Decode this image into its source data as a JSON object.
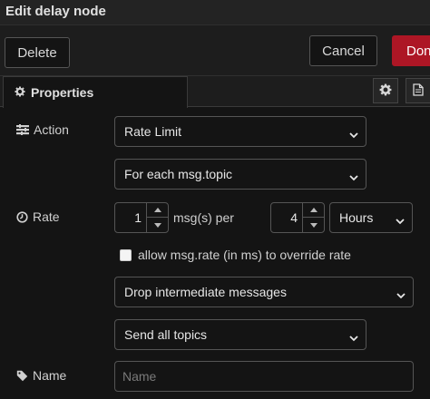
{
  "header": {
    "title": "Edit delay node"
  },
  "toolbar": {
    "delete_label": "Delete",
    "cancel_label": "Cancel",
    "done_label": "Done"
  },
  "tabs": {
    "properties_label": "Properties"
  },
  "form": {
    "action_label": "Action",
    "action_value": "Rate Limit",
    "scope_value": "For each msg.topic",
    "rate_label": "Rate",
    "rate_count": "1",
    "rate_unit_text": "msg(s) per",
    "rate_period": "4",
    "rate_period_unit": "Hours",
    "override_label": "allow msg.rate (in ms) to override rate",
    "drop_value": "Drop intermediate messages",
    "topics_value": "Send all topics",
    "name_label": "Name",
    "name_placeholder": "Name"
  },
  "colors": {
    "done_button": "#ad1625",
    "background": "#141414",
    "border": "#555555"
  },
  "icons": [
    "gear-icon",
    "file-icon",
    "list-icon",
    "clock-icon",
    "tag-icon",
    "chevron-down-icon",
    "caret-up-icon",
    "caret-down-icon"
  ]
}
